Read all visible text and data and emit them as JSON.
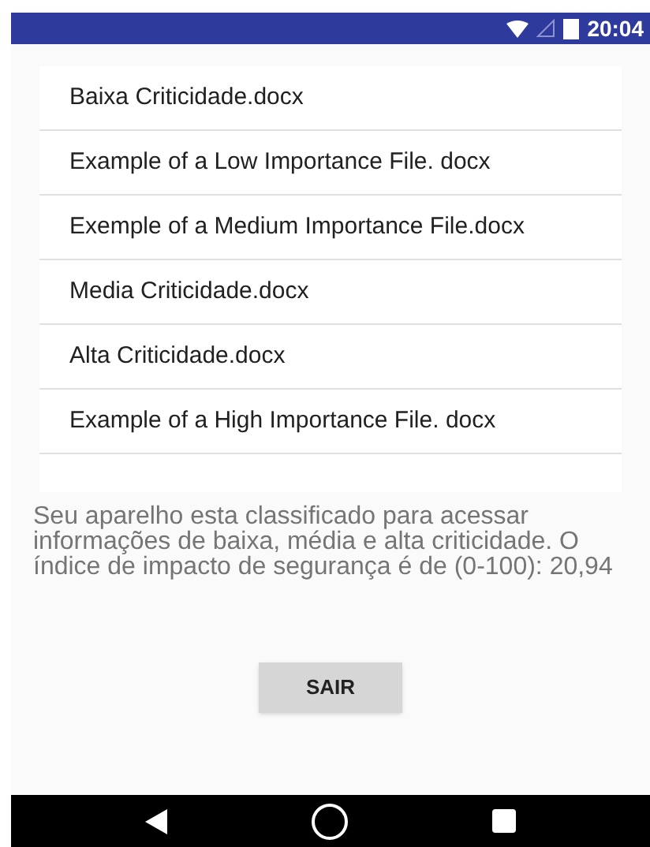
{
  "status_bar": {
    "time": "20:04"
  },
  "files": [
    {
      "name": "Baixa Criticidade.docx"
    },
    {
      "name": "Example of a Low Importance File. docx"
    },
    {
      "name": "Exemple of a Medium Importance File.docx"
    },
    {
      "name": "Media Criticidade.docx"
    },
    {
      "name": "Alta Criticidade.docx"
    },
    {
      "name": "Example of a High Importance File. docx"
    }
  ],
  "message": "Seu aparelho esta classificado para acessar informações de baixa, média e alta criticidade. O índice de impacto de segurança é de (0-100): 20,94",
  "button": "SAIR"
}
